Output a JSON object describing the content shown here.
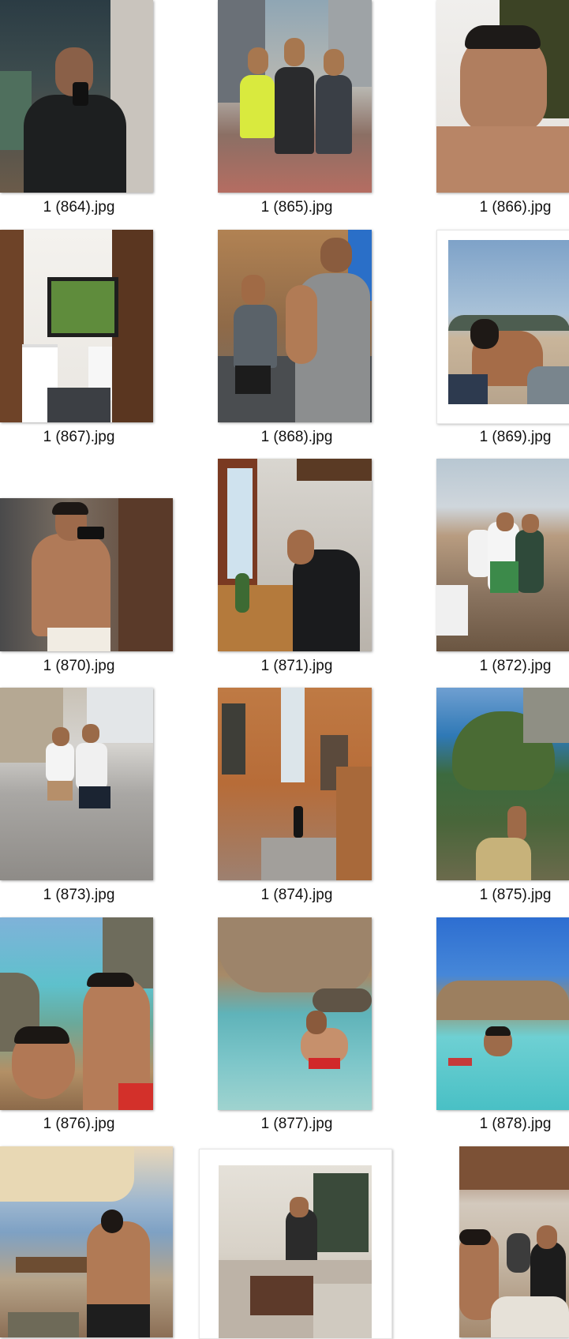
{
  "files": [
    {
      "name": "1 (864).jpg"
    },
    {
      "name": "1 (865).jpg"
    },
    {
      "name": "1 (866).jpg"
    },
    {
      "name": "1 (867).jpg"
    },
    {
      "name": "1 (868).jpg"
    },
    {
      "name": "1 (869).jpg"
    },
    {
      "name": "1 (870).jpg"
    },
    {
      "name": "1 (871).jpg"
    },
    {
      "name": "1 (872).jpg"
    },
    {
      "name": "1 (873).jpg"
    },
    {
      "name": "1 (874).jpg"
    },
    {
      "name": "1 (875).jpg"
    },
    {
      "name": "1 (876).jpg"
    },
    {
      "name": "1 (877).jpg"
    },
    {
      "name": "1 (878).jpg"
    },
    {
      "name": ""
    },
    {
      "name": ""
    },
    {
      "name": ""
    }
  ]
}
